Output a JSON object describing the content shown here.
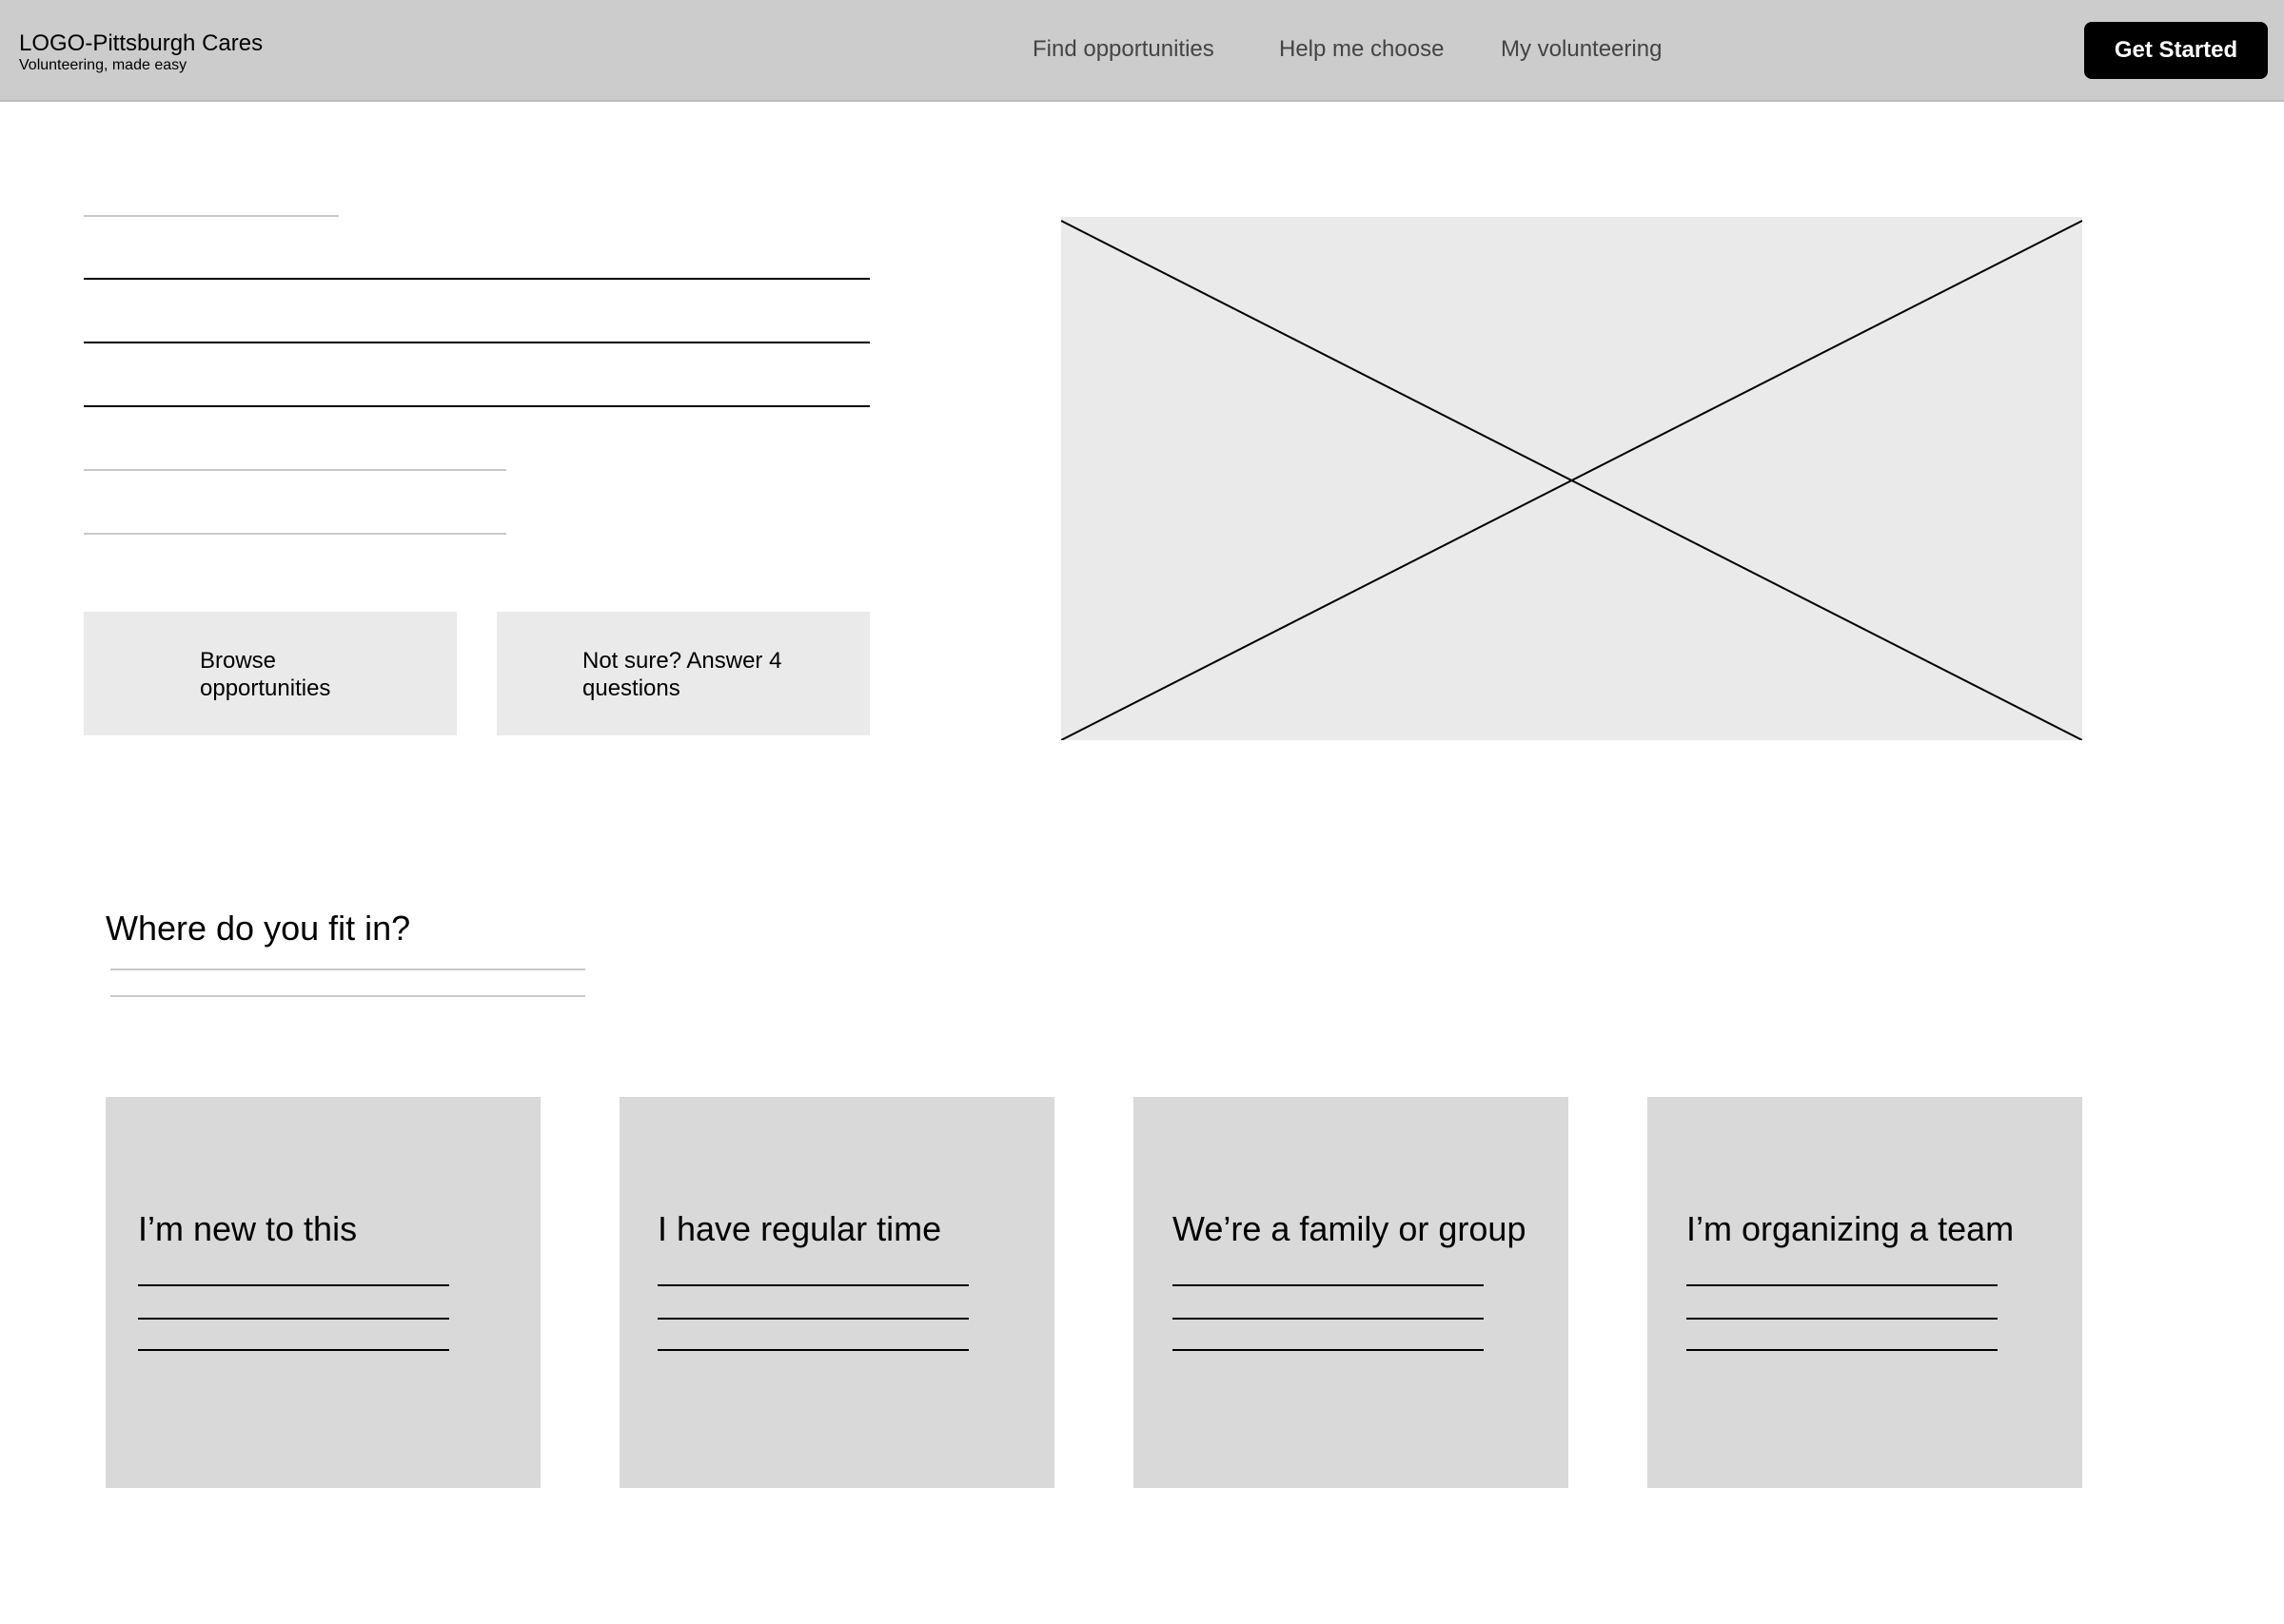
{
  "header": {
    "brand_title": "LOGO-Pittsburgh Cares",
    "brand_tagline": "Volunteering, made easy",
    "nav": {
      "find": "Find opportunities",
      "help": "Help me choose",
      "mine": "My volunteering"
    },
    "cta_label": "Get Started"
  },
  "hero": {
    "browse_label": "Browse opportunities",
    "quiz_label": "Not sure? Answer 4 questions",
    "image_placeholder": "image-placeholder"
  },
  "section": {
    "title": "Where do you fit in?"
  },
  "cards": [
    {
      "title": "I’m new to this"
    },
    {
      "title": "I have regular time"
    },
    {
      "title": "We’re a family or group"
    },
    {
      "title": "I’m organizing a team"
    }
  ],
  "colors": {
    "header_bg": "#cccccc",
    "cta_bg": "#000000",
    "cta_text": "#ffffff",
    "placeholder_bg": "#eaeaea",
    "card_bg": "#d9d9d9"
  }
}
